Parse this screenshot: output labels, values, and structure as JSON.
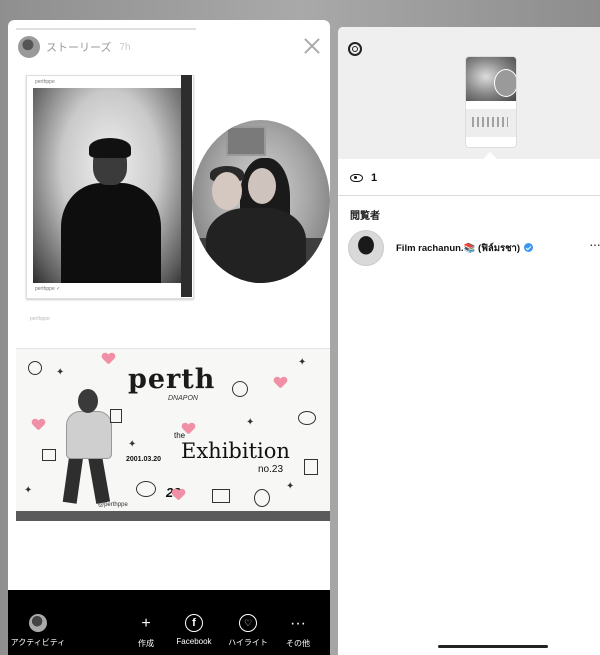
{
  "story": {
    "account_name": "ストーリーズ",
    "time_ago": "7h",
    "polaroid_handle": "perthppe",
    "polaroid_caption": "perthppe ✓",
    "caption_small": "perthppe",
    "poster": {
      "title": "perth",
      "subtitle": "DNAPON",
      "the": "the",
      "exhibition": "Exhibition",
      "number": "no.23",
      "date": "2001.03.20",
      "big_number": "28",
      "tag": "@perthppe"
    }
  },
  "bottom_bar": {
    "activity_label": "アクティビティ",
    "create_label": "作成",
    "facebook_label": "Facebook",
    "highlight_label": "ハイライト",
    "more_label": "その他",
    "create_icon": "+",
    "facebook_icon": "f",
    "highlight_icon": "♡",
    "more_icon": "···"
  },
  "viewers_panel": {
    "view_count": "1",
    "viewers_header": "閲覧者",
    "viewers": [
      {
        "name": "Film rachanun.📚 (ฟิล์มรชา)",
        "verified": true
      }
    ],
    "more_icon": "···"
  },
  "colors": {
    "verified_blue": "#3897f0",
    "heart_pink": "#f08fa6"
  }
}
